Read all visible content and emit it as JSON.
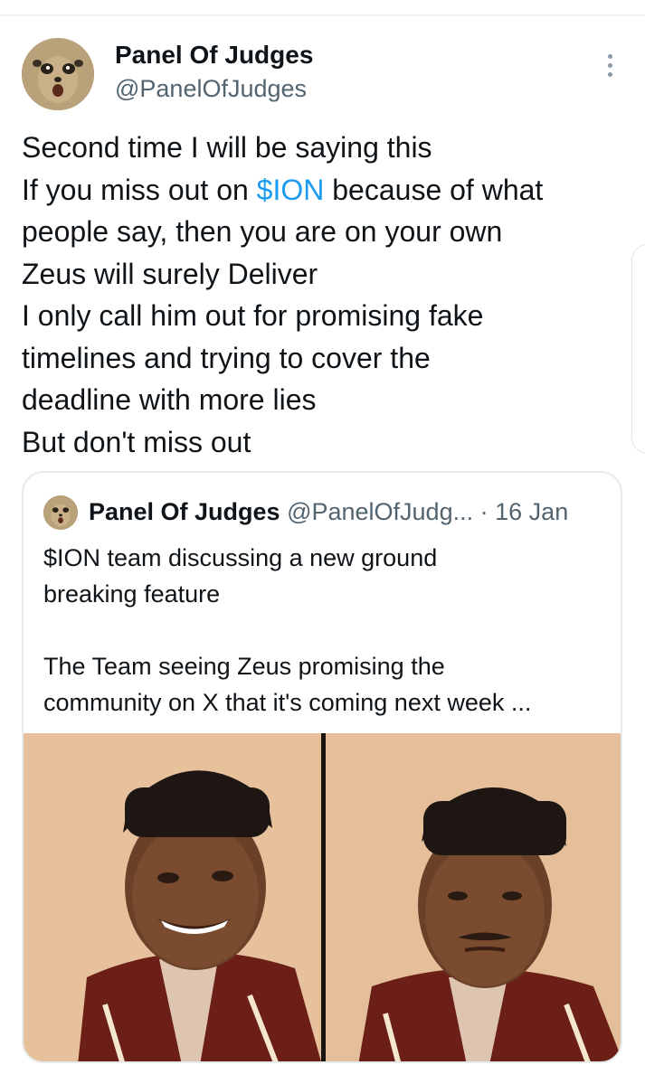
{
  "tweet": {
    "author_name": "Panel Of Judges",
    "author_handle": "@PanelOfJudges",
    "lines": [
      "Second time I will be saying this",
      [
        "If you miss out on ",
        "$ION",
        " because of what"
      ],
      "people say, then you are on your own",
      "Zeus will surely Deliver",
      "I only call him out for promising fake",
      "timelines and trying to cover the",
      "deadline with more lies",
      "But don't miss out"
    ],
    "line_1_pre": "If you miss out on ",
    "line_1_tag": "$ION",
    "line_1_post": " because of what"
  },
  "quote": {
    "author_name": "Panel Of Judges",
    "author_handle": "@PanelOfJudg...",
    "separator": "·",
    "date": "16 Jan",
    "text_lines": [
      "$ION team discussing a new ground",
      "breaking feature",
      "",
      "The Team seeing Zeus promising the",
      "community on X that it's coming next week ..."
    ]
  },
  "icons": {
    "more": "more-vertical-icon"
  },
  "colors": {
    "link": "#1d9bf0",
    "secondary_text": "#536471",
    "primary_text": "#0f1419"
  }
}
